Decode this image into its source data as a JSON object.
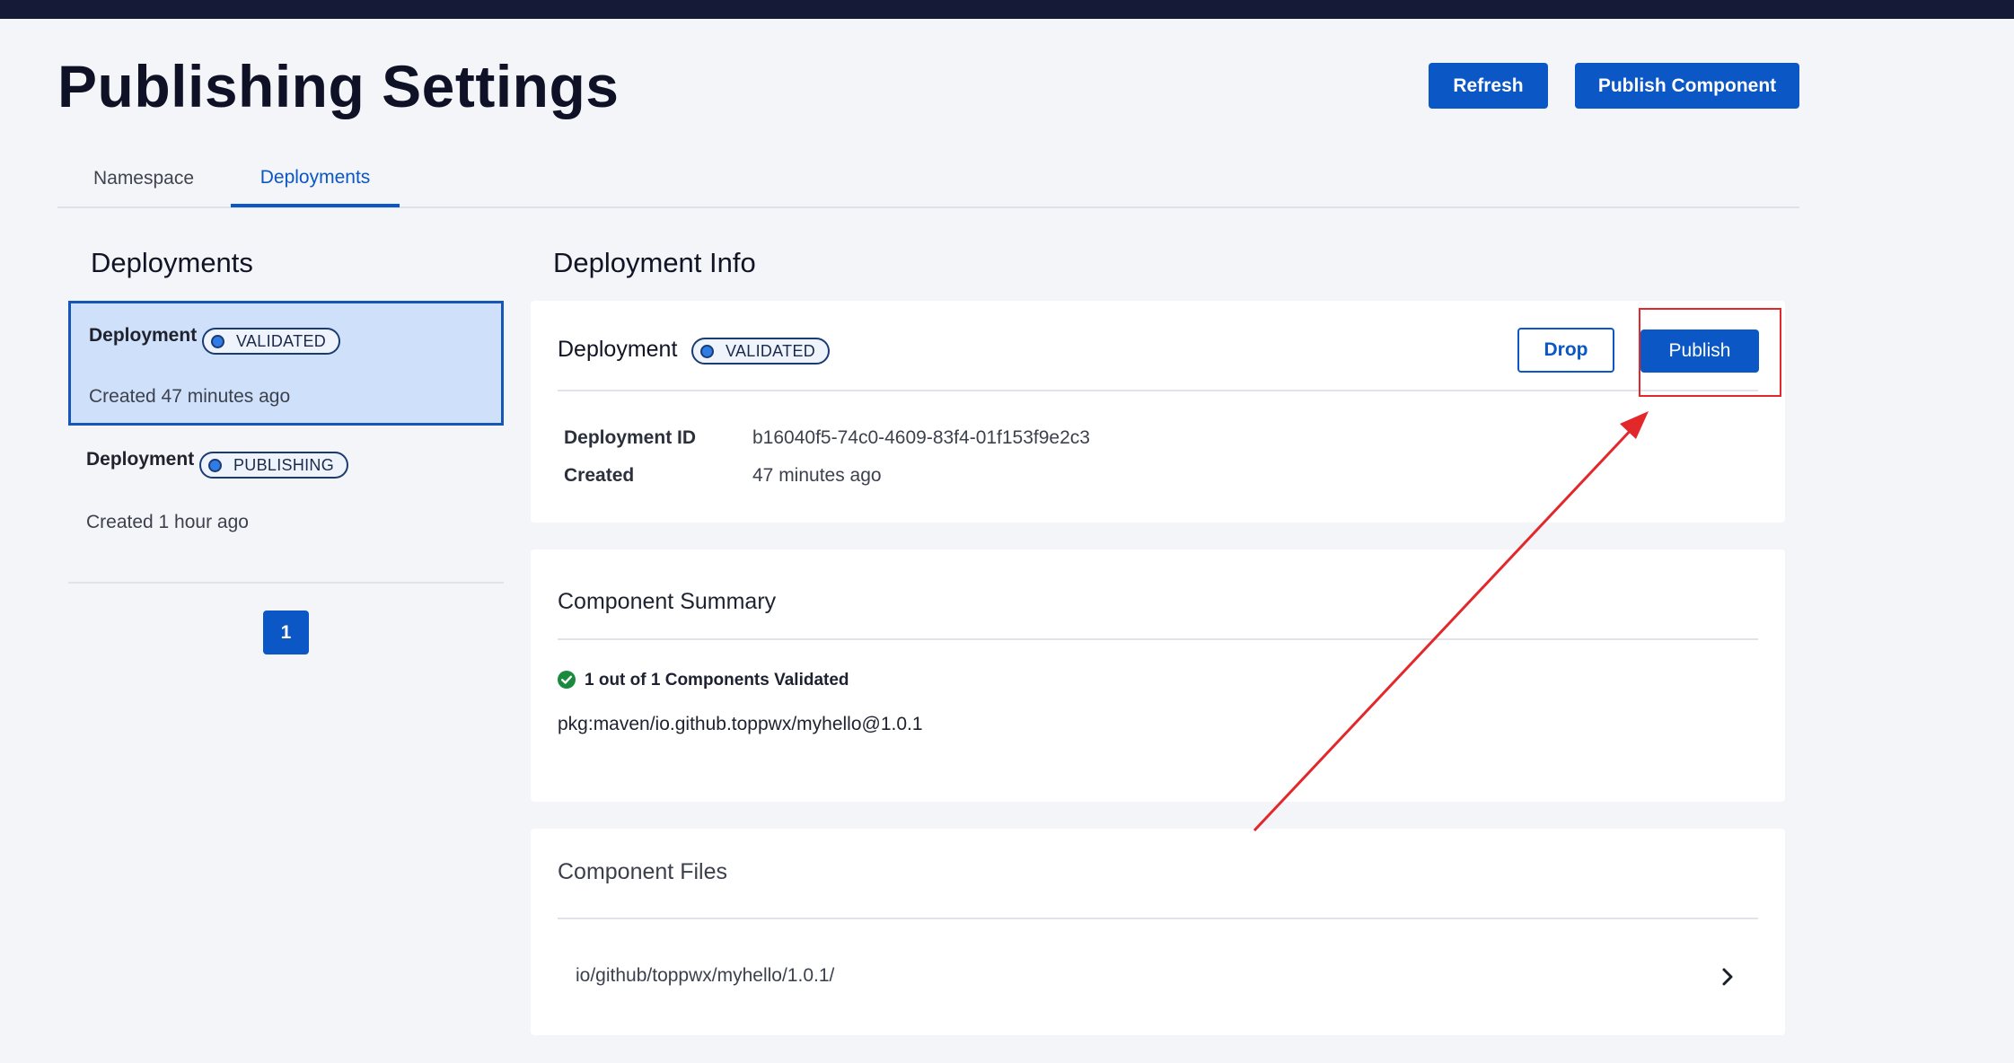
{
  "header": {
    "title": "Publishing Settings",
    "refresh_label": "Refresh",
    "publish_component_label": "Publish Component"
  },
  "tabs": [
    {
      "label": "Namespace",
      "active": false
    },
    {
      "label": "Deployments",
      "active": true
    }
  ],
  "deployments_panel": {
    "heading": "Deployments",
    "items": [
      {
        "name": "Deployment",
        "status": "VALIDATED",
        "created": "Created 47 minutes ago",
        "selected": true
      },
      {
        "name": "Deployment",
        "status": "PUBLISHING",
        "created": "Created 1 hour ago",
        "selected": false
      }
    ],
    "pagination": {
      "current_page": "1"
    }
  },
  "deployment_info": {
    "heading": "Deployment Info",
    "title": "Deployment",
    "status": "VALIDATED",
    "drop_label": "Drop",
    "publish_label": "Publish",
    "fields": [
      {
        "label": "Deployment ID",
        "value": "b16040f5-74c0-4609-83f4-01f153f9e2c3"
      },
      {
        "label": "Created",
        "value": "47 minutes ago"
      }
    ]
  },
  "component_summary": {
    "title": "Component Summary",
    "status_text": "1 out of 1 Components Validated",
    "package": "pkg:maven/io.github.toppwx/myhello@1.0.1"
  },
  "component_files": {
    "title": "Component Files",
    "items": [
      {
        "path": "io/github/toppwx/myhello/1.0.1/"
      }
    ]
  },
  "colors": {
    "primary": "#0b57c5",
    "selected_card_bg": "#cfe0fa",
    "status_dot": "#2f7ce6",
    "success": "#1a8a3c",
    "annotation": "#e3282c",
    "topbar": "#151a37"
  },
  "icons": {
    "status_dot": "status-dot-icon",
    "check": "check-circle-icon",
    "chevron": "chevron-right-icon"
  }
}
